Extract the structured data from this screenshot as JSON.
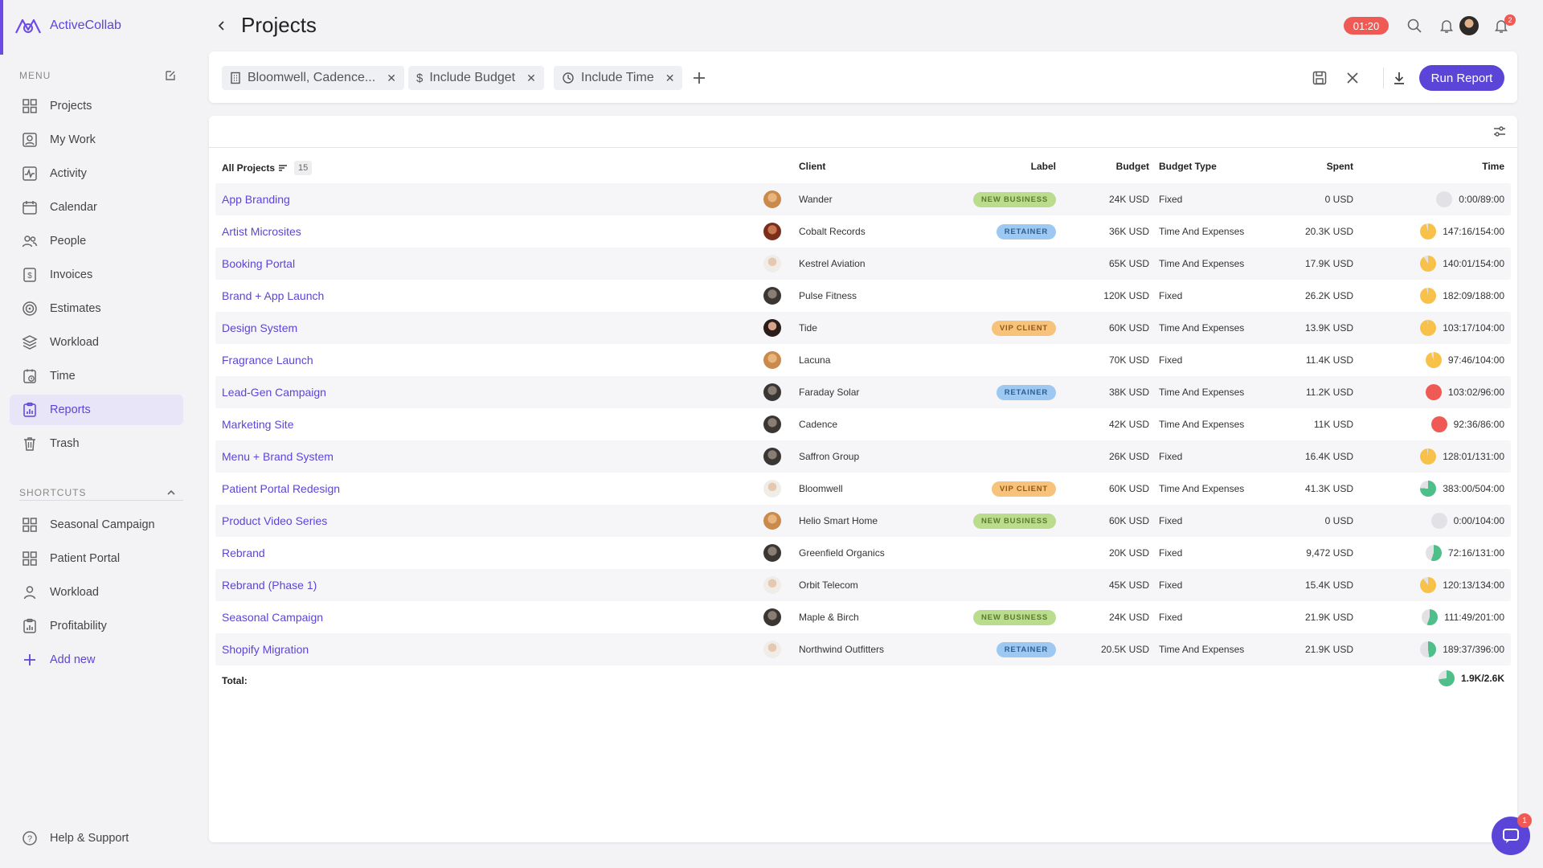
{
  "app": {
    "name": "ActiveCollab"
  },
  "sidebar": {
    "menu_heading": "MENU",
    "items": [
      {
        "label": "Projects",
        "icon": "grid-icon"
      },
      {
        "label": "My Work",
        "icon": "person-card-icon"
      },
      {
        "label": "Activity",
        "icon": "activity-icon"
      },
      {
        "label": "Calendar",
        "icon": "calendar-icon"
      },
      {
        "label": "People",
        "icon": "people-icon"
      },
      {
        "label": "Invoices",
        "icon": "invoice-icon"
      },
      {
        "label": "Estimates",
        "icon": "target-icon"
      },
      {
        "label": "Workload",
        "icon": "layers-icon"
      },
      {
        "label": "Time",
        "icon": "clock-icon"
      },
      {
        "label": "Reports",
        "icon": "report-icon",
        "active": true
      },
      {
        "label": "Trash",
        "icon": "trash-icon"
      }
    ],
    "shortcuts_heading": "SHORTCUTS",
    "shortcuts": [
      {
        "label": "Seasonal Campaign",
        "icon": "grid-icon"
      },
      {
        "label": "Patient Portal",
        "icon": "grid-icon"
      },
      {
        "label": "Workload",
        "icon": "person-icon"
      },
      {
        "label": "Profitability",
        "icon": "report-icon"
      }
    ],
    "add_new": "Add new",
    "help": "Help & Support"
  },
  "header": {
    "title": "Projects",
    "timer": "01:20",
    "notifications_count": "2"
  },
  "filters": {
    "chips": [
      {
        "label": "Bloomwell, Cadence...",
        "icon": "building-icon"
      },
      {
        "label": "Include Budget",
        "icon": "dollar-icon"
      },
      {
        "label": "Include Time",
        "icon": "clock-icon"
      }
    ],
    "run_report": "Run Report"
  },
  "table": {
    "headers": {
      "name": "All Projects",
      "count": "15",
      "client": "Client",
      "label": "Label",
      "budget": "Budget",
      "budget_type": "Budget Type",
      "spent": "Spent",
      "time": "Time"
    },
    "rows": [
      {
        "name": "App Branding",
        "client": "Wander",
        "label": "NEW BUSINESS",
        "budget": "24K USD",
        "budget_type": "Fixed",
        "spent": "0 USD",
        "time": "0:00/89:00",
        "time_used_fraction": 0.0
      },
      {
        "name": "Artist Microsites",
        "client": "Cobalt Records",
        "label": "RETAINER",
        "budget": "36K USD",
        "budget_type": "Time And Expenses",
        "spent": "20.3K USD",
        "time": "147:16/154:00",
        "time_used_fraction": 0.956
      },
      {
        "name": "Booking Portal",
        "client": "Kestrel Aviation",
        "label": "",
        "budget": "65K USD",
        "budget_type": "Time And Expenses",
        "spent": "17.9K USD",
        "time": "140:01/154:00",
        "time_used_fraction": 0.909
      },
      {
        "name": "Brand + App Launch",
        "client": "Pulse Fitness",
        "label": "",
        "budget": "120K USD",
        "budget_type": "Fixed",
        "spent": "26.2K USD",
        "time": "182:09/188:00",
        "time_used_fraction": 0.969
      },
      {
        "name": "Design System",
        "client": "Tide",
        "label": "VIP CLIENT",
        "budget": "60K USD",
        "budget_type": "Time And Expenses",
        "spent": "13.9K USD",
        "time": "103:17/104:00",
        "time_used_fraction": 0.993
      },
      {
        "name": "Fragrance Launch",
        "client": "Lacuna",
        "label": "",
        "budget": "70K USD",
        "budget_type": "Fixed",
        "spent": "11.4K USD",
        "time": "97:46/104:00",
        "time_used_fraction": 0.94
      },
      {
        "name": "Lead-Gen Campaign",
        "client": "Faraday Solar",
        "label": "RETAINER",
        "budget": "38K USD",
        "budget_type": "Time And Expenses",
        "spent": "11.2K USD",
        "time": "103:02/96:00",
        "time_used_fraction": 1.073
      },
      {
        "name": "Marketing Site",
        "client": "Cadence",
        "label": "",
        "budget": "42K USD",
        "budget_type": "Time And Expenses",
        "spent": "11K USD",
        "time": "92:36/86:00",
        "time_used_fraction": 1.077
      },
      {
        "name": "Menu + Brand System",
        "client": "Saffron Group",
        "label": "",
        "budget": "26K USD",
        "budget_type": "Fixed",
        "spent": "16.4K USD",
        "time": "128:01/131:00",
        "time_used_fraction": 0.977
      },
      {
        "name": "Patient Portal Redesign",
        "client": "Bloomwell",
        "label": "VIP CLIENT",
        "budget": "60K USD",
        "budget_type": "Time And Expenses",
        "spent": "41.3K USD",
        "time": "383:00/504:00",
        "time_used_fraction": 0.76
      },
      {
        "name": "Product Video Series",
        "client": "Helio Smart Home",
        "label": "NEW BUSINESS",
        "budget": "60K USD",
        "budget_type": "Fixed",
        "spent": "0 USD",
        "time": "0:00/104:00",
        "time_used_fraction": 0.0
      },
      {
        "name": "Rebrand",
        "client": "Greenfield Organics",
        "label": "",
        "budget": "20K USD",
        "budget_type": "Fixed",
        "spent": "9,472 USD",
        "time": "72:16/131:00",
        "time_used_fraction": 0.552
      },
      {
        "name": "Rebrand (Phase 1)",
        "client": "Orbit Telecom",
        "label": "",
        "budget": "45K USD",
        "budget_type": "Fixed",
        "spent": "15.4K USD",
        "time": "120:13/134:00",
        "time_used_fraction": 0.897
      },
      {
        "name": "Seasonal Campaign",
        "client": "Maple & Birch",
        "label": "NEW BUSINESS",
        "budget": "24K USD",
        "budget_type": "Fixed",
        "spent": "21.9K USD",
        "time": "111:49/201:00",
        "time_used_fraction": 0.556
      },
      {
        "name": "Shopify Migration",
        "client": "Northwind Outfitters",
        "label": "RETAINER",
        "budget": "20.5K USD",
        "budget_type": "Time And Expenses",
        "spent": "21.9K USD",
        "time": "189:37/396:00",
        "time_used_fraction": 0.479
      }
    ],
    "total_label": "Total:",
    "total_time": "1.9K/2.6K",
    "total_time_used_fraction": 0.73
  },
  "chat": {
    "badge": "1"
  },
  "colors": {
    "accent": "#5b45d9",
    "badge_new_business": "#b9dd8c",
    "badge_retainer": "#9cc8f2",
    "badge_vip_client": "#f7c27a",
    "pie_empty": "#e2e2e6",
    "pie_yellow": "#f8c24a",
    "pie_red": "#ef5a55",
    "pie_green": "#4fbf8a"
  }
}
